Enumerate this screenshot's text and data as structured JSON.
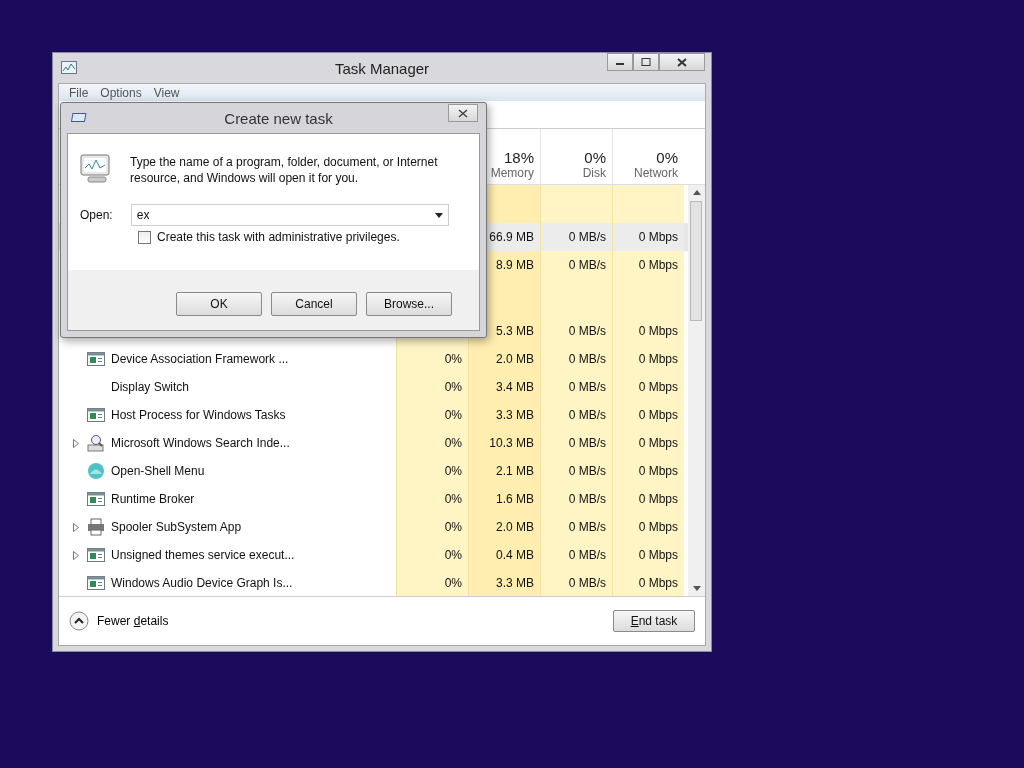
{
  "task_manager": {
    "title": "Task Manager",
    "menu": [
      "File",
      "Options",
      "View"
    ],
    "columns": [
      {
        "percent": "18%",
        "label": "Memory"
      },
      {
        "percent": "0%",
        "label": "Disk"
      },
      {
        "percent": "0%",
        "label": "Network"
      }
    ],
    "rows": [
      {
        "kind": "group"
      },
      {
        "kind": "process",
        "selected": true,
        "memory": "66.9 MB",
        "disk": "0 MB/s",
        "network": "0 Mbps"
      },
      {
        "kind": "process",
        "selected": false,
        "memory": "8.9 MB",
        "disk": "0 MB/s",
        "network": "0 Mbps"
      },
      {
        "kind": "group"
      },
      {
        "kind": "process",
        "selected": false,
        "memory": "5.3 MB",
        "disk": "0 MB/s",
        "network": "0 Mbps"
      },
      {
        "kind": "process",
        "selected": false,
        "expandable": false,
        "name": "Device Association Framework ...",
        "cpu": "0%",
        "memory": "2.0 MB",
        "disk": "0 MB/s",
        "network": "0 Mbps"
      },
      {
        "kind": "process",
        "selected": false,
        "expandable": false,
        "name": "Display Switch",
        "cpu": "0%",
        "memory": "3.4 MB",
        "disk": "0 MB/s",
        "network": "0 Mbps"
      },
      {
        "kind": "process",
        "selected": false,
        "expandable": false,
        "name": "Host Process for Windows Tasks",
        "cpu": "0%",
        "memory": "3.3 MB",
        "disk": "0 MB/s",
        "network": "0 Mbps"
      },
      {
        "kind": "process",
        "selected": false,
        "expandable": true,
        "name": "Microsoft Windows Search Inde...",
        "cpu": "0%",
        "memory": "10.3 MB",
        "disk": "0 MB/s",
        "network": "0 Mbps"
      },
      {
        "kind": "process",
        "selected": false,
        "expandable": false,
        "name": "Open-Shell Menu",
        "cpu": "0%",
        "memory": "2.1 MB",
        "disk": "0 MB/s",
        "network": "0 Mbps"
      },
      {
        "kind": "process",
        "selected": false,
        "expandable": false,
        "name": "Runtime Broker",
        "cpu": "0%",
        "memory": "1.6 MB",
        "disk": "0 MB/s",
        "network": "0 Mbps"
      },
      {
        "kind": "process",
        "selected": false,
        "expandable": true,
        "name": "Spooler SubSystem App",
        "cpu": "0%",
        "memory": "2.0 MB",
        "disk": "0 MB/s",
        "network": "0 Mbps"
      },
      {
        "kind": "process",
        "selected": false,
        "expandable": true,
        "name": "Unsigned themes service execut...",
        "cpu": "0%",
        "memory": "0.4 MB",
        "disk": "0 MB/s",
        "network": "0 Mbps"
      },
      {
        "kind": "process",
        "selected": false,
        "expandable": false,
        "name": "Windows Audio Device Graph Is...",
        "cpu": "0%",
        "memory": "3.3 MB",
        "disk": "0 MB/s",
        "network": "0 Mbps"
      }
    ],
    "fewer_details": "Fewer **d**etails",
    "end_task": "**E**nd task"
  },
  "dialog": {
    "title": "Create new task",
    "message": "Type the name of a program, folder, document, or Internet resource, and Windows will open it for you.",
    "open_label": "Open:",
    "open_value": "ex",
    "admin_checkbox": {
      "label": "Create this task with administrative privileges.",
      "checked": false
    },
    "buttons": [
      "OK",
      "Cancel",
      "Browse..."
    ]
  }
}
